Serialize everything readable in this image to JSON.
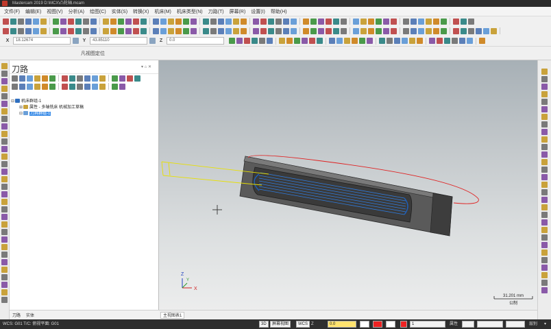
{
  "titlebar": {
    "title": "Mastercam 2019  D:\\MCX\\凸轮轴.mcam"
  },
  "menu": [
    "文件(F)",
    "编辑(E)",
    "视图(V)",
    "分析(A)",
    "绘图(C)",
    "实体(S)",
    "转换(X)",
    "机床(M)",
    "机床类型(N)",
    "刀路(T)",
    "屏幕(R)",
    "设置(I)",
    "帮助(H)"
  ],
  "coords": {
    "x_label": "X",
    "x_value": "18.12674",
    "y_label": "Y",
    "y_value": "43.85110",
    "z_label": "Z",
    "z_value": "0.0"
  },
  "plane_title": "凡视图定位",
  "panel": {
    "title": "刀路",
    "pin": "▾ ⌂ ✕",
    "tree": {
      "root": "机床群组-1",
      "child1": "属性 - 多轴铣床 机械加工草稿",
      "child2": "刀具群组-1"
    },
    "tabs": [
      "刀路",
      "实体"
    ]
  },
  "viewport": {
    "scale_value": "31.201 mm",
    "scale_unit": "公制",
    "axis_x": "X",
    "axis_y": "Y",
    "axis_z": "Z"
  },
  "viewsheet": {
    "tab_label": "主视图表1"
  },
  "status": {
    "left": "WCS: G01   T/C: 俯视平面: G01",
    "mode1": "3D",
    "mode2": "屏幕视图",
    "mode3": "WCS",
    "z_label": "Z",
    "z_value": "0.0",
    "layer_label": "层别",
    "layer_value": "1",
    "attr_label": "属性",
    "level_label": "层别",
    "end": "▾"
  },
  "colors": {
    "accent": "#3d8ee8",
    "toolpath_blue": "#2f7de1",
    "boundary_red": "#e02020",
    "approach_yellow": "#e8e000"
  }
}
